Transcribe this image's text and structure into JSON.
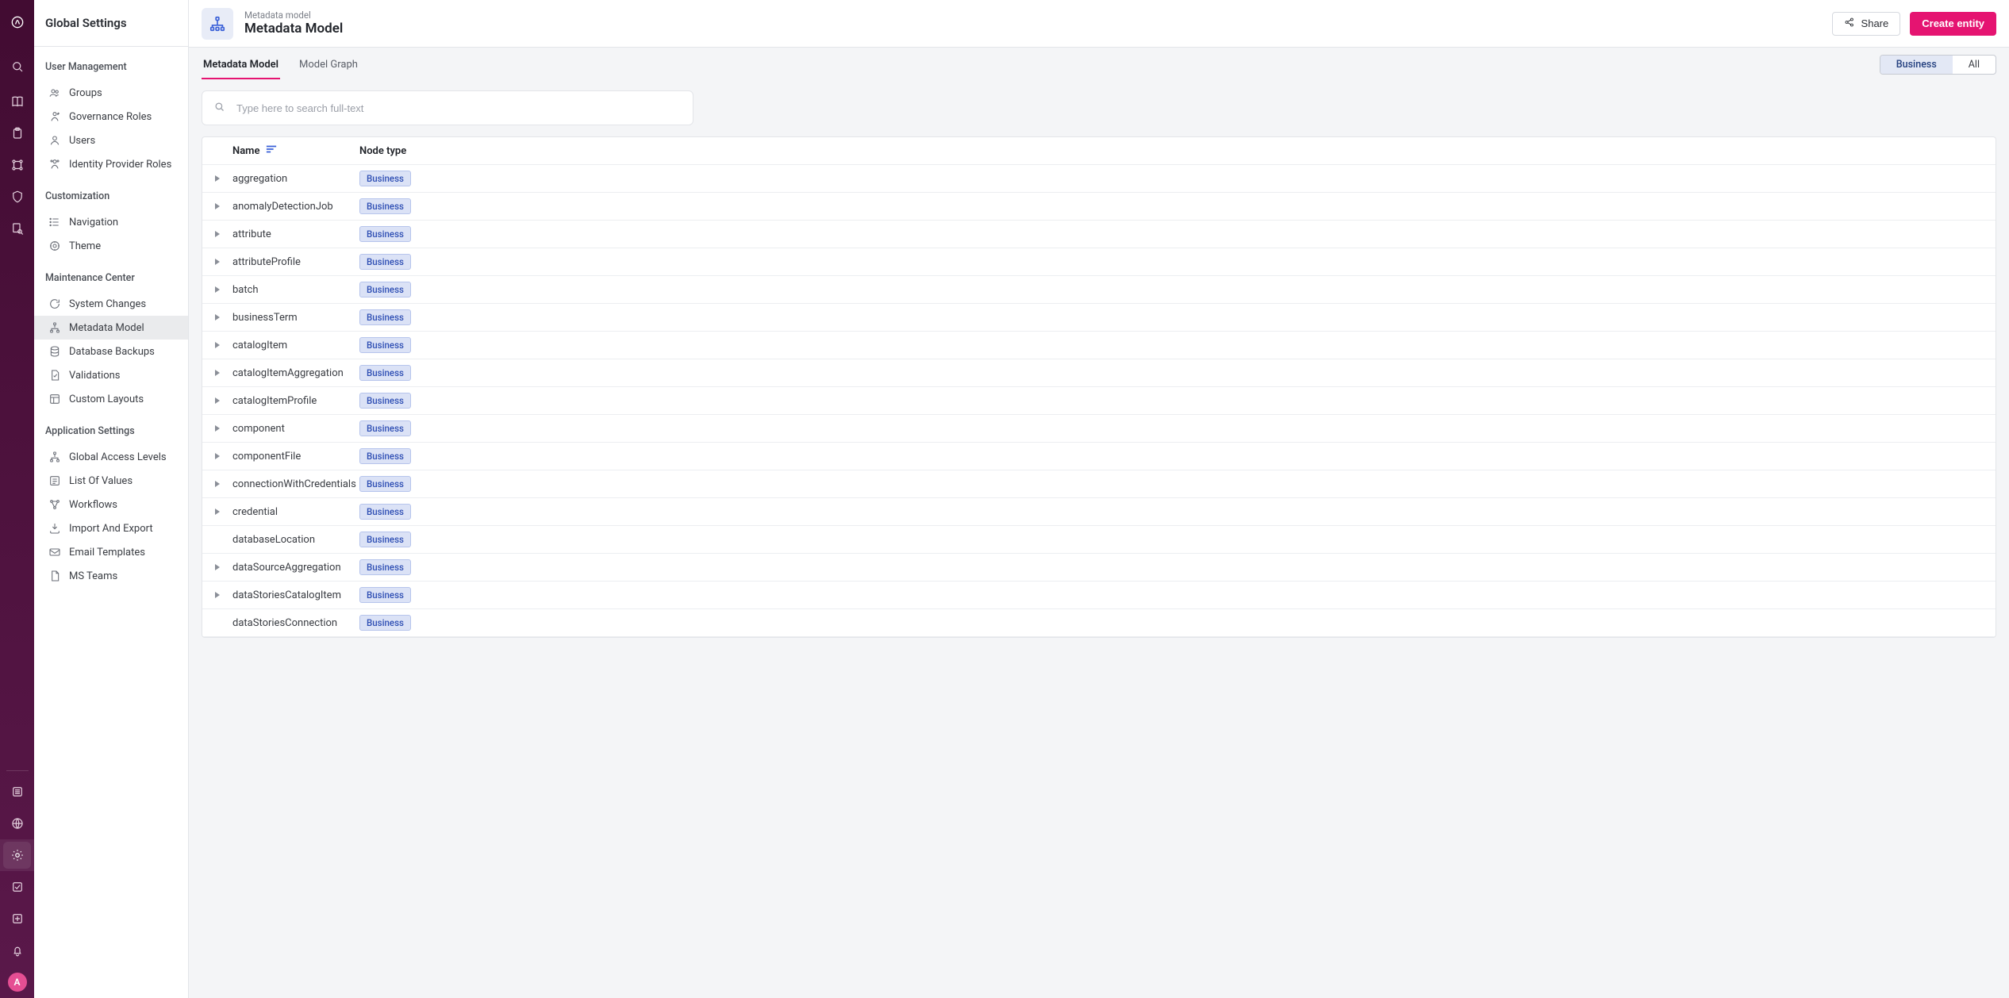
{
  "rail": {
    "avatar_letter": "A"
  },
  "sidebar": {
    "title": "Global Settings",
    "sections": [
      {
        "title": "User Management",
        "items": [
          {
            "label": "Groups",
            "icon": "users"
          },
          {
            "label": "Governance Roles",
            "icon": "gov"
          },
          {
            "label": "Users",
            "icon": "user"
          },
          {
            "label": "Identity Provider Roles",
            "icon": "idp"
          }
        ]
      },
      {
        "title": "Customization",
        "items": [
          {
            "label": "Navigation",
            "icon": "list"
          },
          {
            "label": "Theme",
            "icon": "palette"
          }
        ]
      },
      {
        "title": "Maintenance Center",
        "items": [
          {
            "label": "System Changes",
            "icon": "sync"
          },
          {
            "label": "Metadata Model",
            "icon": "sitemap",
            "active": true
          },
          {
            "label": "Database Backups",
            "icon": "db"
          },
          {
            "label": "Validations",
            "icon": "page-check"
          },
          {
            "label": "Custom Layouts",
            "icon": "layout"
          }
        ]
      },
      {
        "title": "Application Settings",
        "items": [
          {
            "label": "Global Access Levels",
            "icon": "sitemap"
          },
          {
            "label": "List Of Values",
            "icon": "lov"
          },
          {
            "label": "Workflows",
            "icon": "wf"
          },
          {
            "label": "Import And Export",
            "icon": "io"
          },
          {
            "label": "Email Templates",
            "icon": "mail"
          },
          {
            "label": "MS Teams",
            "icon": "page"
          }
        ]
      }
    ]
  },
  "header": {
    "breadcrumb": "Metadata model",
    "title": "Metadata Model",
    "share_label": "Share",
    "create_label": "Create entity"
  },
  "tabs": {
    "items": [
      {
        "label": "Metadata Model",
        "active": true
      },
      {
        "label": "Model Graph"
      }
    ],
    "filter": {
      "options": [
        {
          "label": "Business",
          "active": true
        },
        {
          "label": "All"
        }
      ]
    }
  },
  "search": {
    "placeholder": "Type here to search full-text"
  },
  "table": {
    "headers": {
      "name": "Name",
      "type": "Node type"
    },
    "rows": [
      {
        "name": "aggregation",
        "type": "Business",
        "expandable": true
      },
      {
        "name": "anomalyDetectionJob",
        "type": "Business",
        "expandable": true
      },
      {
        "name": "attribute",
        "type": "Business",
        "expandable": true
      },
      {
        "name": "attributeProfile",
        "type": "Business",
        "expandable": true
      },
      {
        "name": "batch",
        "type": "Business",
        "expandable": true
      },
      {
        "name": "businessTerm",
        "type": "Business",
        "expandable": true
      },
      {
        "name": "catalogItem",
        "type": "Business",
        "expandable": true
      },
      {
        "name": "catalogItemAggregation",
        "type": "Business",
        "expandable": true
      },
      {
        "name": "catalogItemProfile",
        "type": "Business",
        "expandable": true
      },
      {
        "name": "component",
        "type": "Business",
        "expandable": true
      },
      {
        "name": "componentFile",
        "type": "Business",
        "expandable": true
      },
      {
        "name": "connectionWithCredentials",
        "type": "Business",
        "expandable": true
      },
      {
        "name": "credential",
        "type": "Business",
        "expandable": true
      },
      {
        "name": "databaseLocation",
        "type": "Business",
        "expandable": false
      },
      {
        "name": "dataSourceAggregation",
        "type": "Business",
        "expandable": true
      },
      {
        "name": "dataStoriesCatalogItem",
        "type": "Business",
        "expandable": true
      },
      {
        "name": "dataStoriesConnection",
        "type": "Business",
        "expandable": false
      }
    ]
  }
}
